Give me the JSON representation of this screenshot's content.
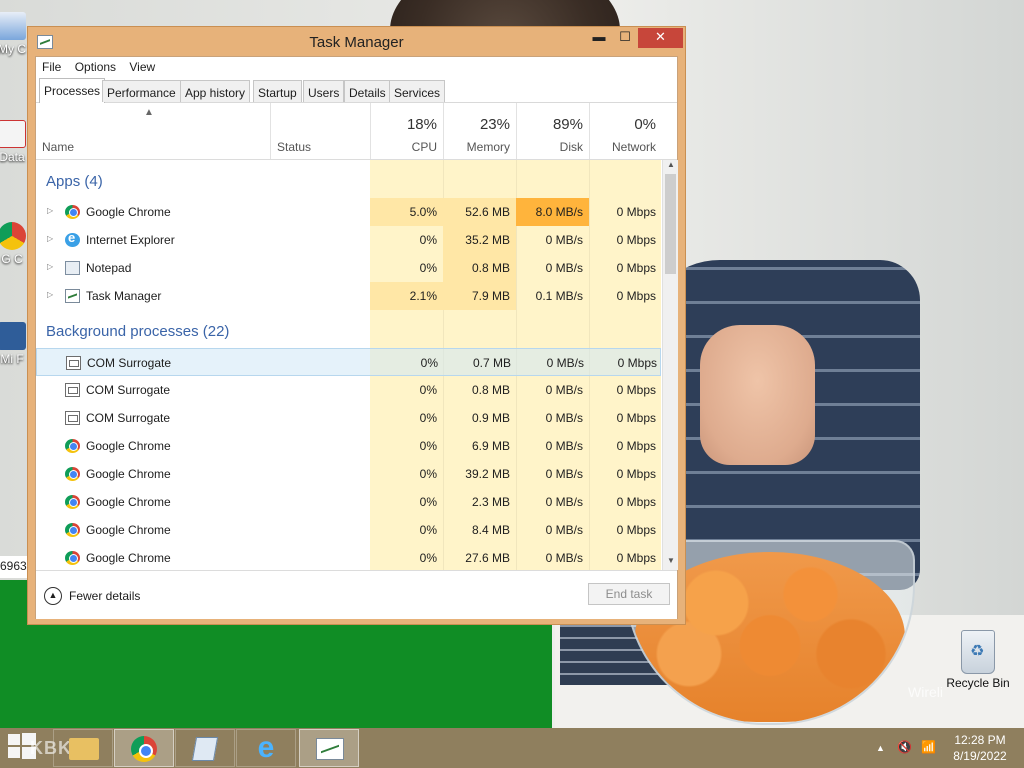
{
  "desktop": {
    "icons": [
      {
        "label": "My C",
        "name": "my-computer"
      },
      {
        "label": "Data",
        "name": "data"
      },
      {
        "label": "G C",
        "name": "google-chrome"
      },
      {
        "label": "Mi F",
        "name": "microsoft-folder"
      }
    ],
    "side_strip_text": "6963",
    "recycle_bin_label": "Recycle Bin",
    "watermark_text": "Wireli"
  },
  "window": {
    "title": "Task Manager",
    "controls": {
      "minimize": "▬",
      "maximize": "☐",
      "close": "✕"
    },
    "menu": [
      "File",
      "Options",
      "View"
    ],
    "tabs": [
      "Processes",
      "Performance",
      "App history",
      "Startup",
      "Users",
      "Details",
      "Services"
    ],
    "active_tab": "Processes",
    "columns": {
      "name": "Name",
      "status": "Status",
      "cpu": {
        "percent": "18%",
        "label": "CPU"
      },
      "memory": {
        "percent": "23%",
        "label": "Memory"
      },
      "disk": {
        "percent": "89%",
        "label": "Disk"
      },
      "network": {
        "percent": "0%",
        "label": "Network"
      }
    },
    "sections": {
      "apps": "Apps (4)",
      "background": "Background processes (22)"
    },
    "apps": [
      {
        "name": "Google Chrome",
        "icon": "chrome-icon",
        "cpu": "5.0%",
        "memory": "52.6 MB",
        "disk": "8.0 MB/s",
        "network": "0 Mbps"
      },
      {
        "name": "Internet Explorer",
        "icon": "ie-icon",
        "cpu": "0%",
        "memory": "35.2 MB",
        "disk": "0 MB/s",
        "network": "0 Mbps"
      },
      {
        "name": "Notepad",
        "icon": "notepad-icon",
        "cpu": "0%",
        "memory": "0.8 MB",
        "disk": "0 MB/s",
        "network": "0 Mbps"
      },
      {
        "name": "Task Manager",
        "icon": "task-manager-icon",
        "cpu": "2.1%",
        "memory": "7.9 MB",
        "disk": "0.1 MB/s",
        "network": "0 Mbps"
      }
    ],
    "background": [
      {
        "name": "COM Surrogate",
        "icon": "com-surrogate-icon",
        "cpu": "0%",
        "memory": "0.7 MB",
        "disk": "0 MB/s",
        "network": "0 Mbps"
      },
      {
        "name": "COM Surrogate",
        "icon": "com-surrogate-icon",
        "cpu": "0%",
        "memory": "0.8 MB",
        "disk": "0 MB/s",
        "network": "0 Mbps"
      },
      {
        "name": "COM Surrogate",
        "icon": "com-surrogate-icon",
        "cpu": "0%",
        "memory": "0.9 MB",
        "disk": "0 MB/s",
        "network": "0 Mbps"
      },
      {
        "name": "Google Chrome",
        "icon": "chrome-icon",
        "cpu": "0%",
        "memory": "6.9 MB",
        "disk": "0 MB/s",
        "network": "0 Mbps"
      },
      {
        "name": "Google Chrome",
        "icon": "chrome-icon",
        "cpu": "0%",
        "memory": "39.2 MB",
        "disk": "0 MB/s",
        "network": "0 Mbps"
      },
      {
        "name": "Google Chrome",
        "icon": "chrome-icon",
        "cpu": "0%",
        "memory": "2.3 MB",
        "disk": "0 MB/s",
        "network": "0 Mbps"
      },
      {
        "name": "Google Chrome",
        "icon": "chrome-icon",
        "cpu": "0%",
        "memory": "8.4 MB",
        "disk": "0 MB/s",
        "network": "0 Mbps"
      },
      {
        "name": "Google Chrome",
        "icon": "chrome-icon",
        "cpu": "0%",
        "memory": "27.6 MB",
        "disk": "0 MB/s",
        "network": "0 Mbps"
      }
    ],
    "footer": {
      "fewer_details": "Fewer details",
      "end_task": "End task"
    },
    "colors": {
      "heat_low": "#fff4c9",
      "heat_mid": "#ffe7a6",
      "heat_high": "#ffb43c",
      "section": "#3a64a8",
      "frame": "#e7b27a"
    }
  },
  "taskbar": {
    "watermark": "KBK",
    "pinned": [
      {
        "name": "file-explorer",
        "icon": "folder-icon"
      },
      {
        "name": "google-chrome",
        "icon": "chrome-icon"
      },
      {
        "name": "notepad",
        "icon": "notepad-icon"
      },
      {
        "name": "internet-explorer",
        "icon": "ie-icon"
      },
      {
        "name": "task-manager",
        "icon": "task-manager-icon"
      }
    ],
    "tray": {
      "chevron": "▲",
      "volume": "🔇",
      "network": "📶"
    },
    "time": "12:28 PM",
    "date": "8/19/2022"
  }
}
